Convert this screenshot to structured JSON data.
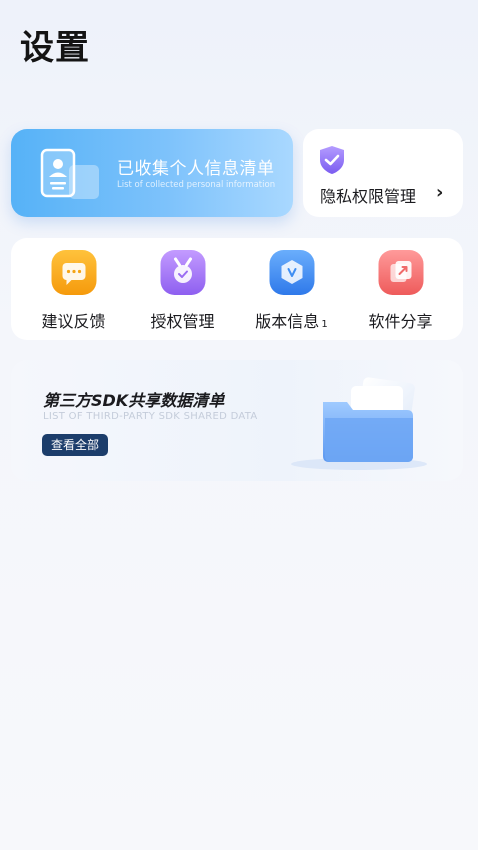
{
  "header": {
    "title": "设置"
  },
  "collected_card": {
    "title": "已收集个人信息清单",
    "subtitle": "List of collected personal information"
  },
  "privacy_card": {
    "label": "隐私权限管理",
    "chevron": "›"
  },
  "grid": {
    "items": [
      {
        "label": "建议反馈",
        "icon": "message-icon",
        "color": "#f7a614"
      },
      {
        "label": "授权管理",
        "icon": "badge-check-icon",
        "color": "#a06cf0"
      },
      {
        "label": "版本信息",
        "badge": "1",
        "icon": "version-icon",
        "color": "#3f8ef2"
      },
      {
        "label": "软件分享",
        "icon": "share-icon",
        "color": "#f26a6a"
      }
    ]
  },
  "sdk_card": {
    "title": "第三方SDK共享数据清单",
    "subtitle": "LIST OF THIRD-PARTY SDK SHARED DATA",
    "button_label": "查看全部"
  },
  "colors": {
    "accent_blue": "#56b2f7",
    "button_navy": "#1c3d6b",
    "shield_purple": "#8a6cf3"
  }
}
